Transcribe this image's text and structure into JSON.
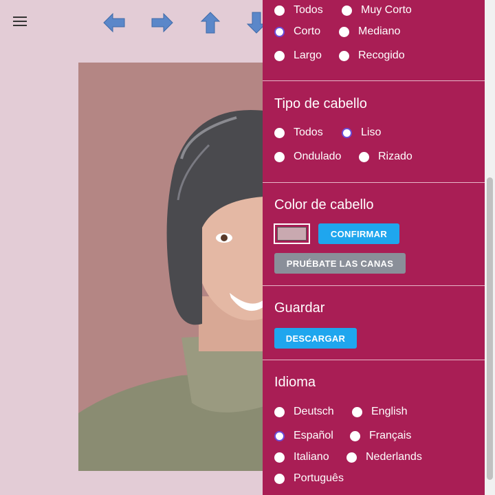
{
  "colors": {
    "background": "#e3ccd6",
    "panel": "#a91e55",
    "accent_button": "#1fa6ee",
    "secondary_button": "#8a8f99",
    "radio_selected": "#6a4cd9",
    "swatch_color": "#c9a9b0"
  },
  "toolbar": {
    "menu_icon": "hamburger-icon",
    "arrows": [
      "arrow-left-icon",
      "arrow-right-icon",
      "arrow-up-icon",
      "arrow-down-icon"
    ]
  },
  "length": {
    "options": [
      {
        "label": "Todos",
        "selected": false
      },
      {
        "label": "Muy Corto",
        "selected": false
      },
      {
        "label": "Corto",
        "selected": true
      },
      {
        "label": "Mediano",
        "selected": false
      },
      {
        "label": "Largo",
        "selected": false
      },
      {
        "label": "Recogido",
        "selected": false
      }
    ]
  },
  "hair_type": {
    "title": "Tipo de cabello",
    "options": [
      {
        "label": "Todos",
        "selected": false
      },
      {
        "label": "Liso",
        "selected": true
      },
      {
        "label": "Ondulado",
        "selected": false
      },
      {
        "label": "Rizado",
        "selected": false
      }
    ]
  },
  "hair_color": {
    "title": "Color de cabello",
    "confirm_label": "CONFIRMAR",
    "gray_label": "PRUÉBATE LAS CANAS"
  },
  "save": {
    "title": "Guardar",
    "download_label": "DESCARGAR"
  },
  "language": {
    "title": "Idioma",
    "options": [
      {
        "label": "Deutsch",
        "selected": false
      },
      {
        "label": "English",
        "selected": false
      },
      {
        "label": "Español",
        "selected": true
      },
      {
        "label": "Français",
        "selected": false
      },
      {
        "label": "Italiano",
        "selected": false
      },
      {
        "label": "Nederlands",
        "selected": false
      },
      {
        "label": "Português",
        "selected": false
      }
    ]
  }
}
